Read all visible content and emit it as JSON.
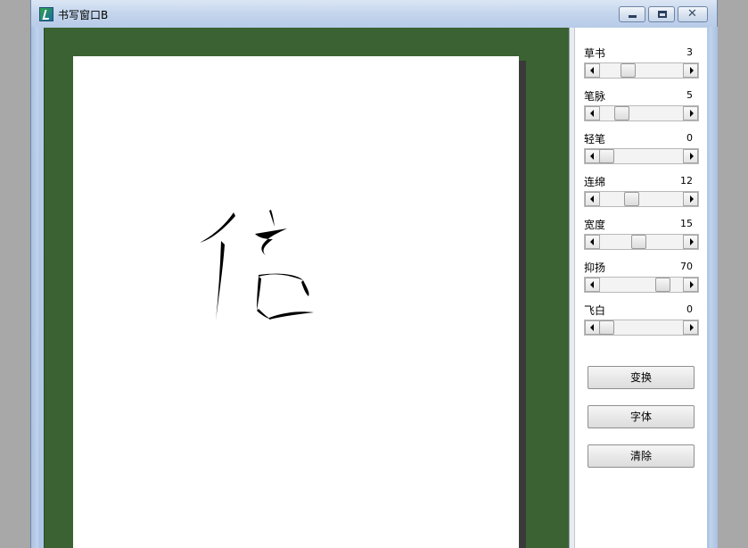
{
  "window": {
    "title": "书写窗口B"
  },
  "canvas": {
    "character": "信",
    "background_color": "#3b6232",
    "paper_color": "#ffffff"
  },
  "sliders": [
    {
      "label": "草书",
      "value": "3",
      "level": 0.25
    },
    {
      "label": "笔脉",
      "value": "5",
      "level": 0.18
    },
    {
      "label": "轻笔",
      "value": "0",
      "level": 0.0
    },
    {
      "label": "连绵",
      "value": "12",
      "level": 0.3
    },
    {
      "label": "宽度",
      "value": "15",
      "level": 0.38
    },
    {
      "label": "抑扬",
      "value": "70",
      "level": 0.67
    },
    {
      "label": "飞白",
      "value": "0",
      "level": 0.0
    }
  ],
  "buttons": {
    "transform": "变换",
    "font": "字体",
    "clear": "清除"
  }
}
